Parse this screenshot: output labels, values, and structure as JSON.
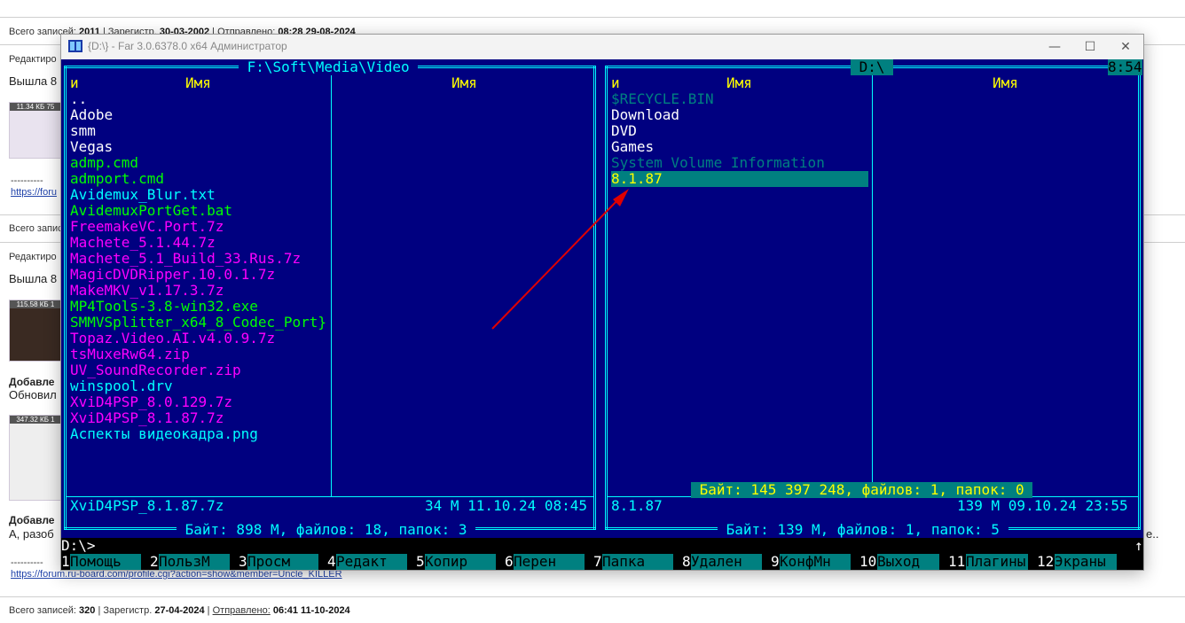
{
  "forum": {
    "top_line": {
      "records_label": "Всего записей:",
      "records": "2011",
      "reg_label": "Зарегистр.",
      "reg_date": "30-03-2002",
      "sent_label": "Отправлено:",
      "sent": "08:28 29-08-2024"
    },
    "edit1": "Редактиро",
    "out1": "Вышла 8",
    "thumb1": "11.34 КБ 75",
    "dashes1": "----------",
    "link1": "https://foru",
    "rec2": "Всего запис",
    "edit2": "Редактиро",
    "out2": "Вышла 8",
    "thumb2": "115.58 КБ 1",
    "added3": "Добавле",
    "upd3": "Обновил",
    "thumb3": "347.32 КБ 1",
    "added4": "Добавле",
    "text4": "А, разоб",
    "text4_tail": "е..",
    "dashes2": "----------",
    "link2": "https://forum.ru-board.com/profile.cgi?action=show&member=Uncle_KILLER",
    "bottom_line": {
      "records_label": "Всего записей:",
      "records": "320",
      "reg_label": "Зарегистр.",
      "reg_date": "27-04-2024",
      "sent_label": "Отправлено:",
      "sent": "06:41 11-10-2024"
    }
  },
  "window": {
    "title": "{D:\\} - Far 3.0.6378.0 x64 Администратор",
    "min_symbol": "—",
    "max_symbol": "☐",
    "close_symbol": "✕"
  },
  "left_panel": {
    "path": " F:\\Soft\\Media\\Video ",
    "col_n": "и",
    "col_name1": "Имя",
    "col_name2": "Имя",
    "files": [
      {
        "name": "..",
        "color": "#ffffff"
      },
      {
        "name": "Adobe",
        "color": "#ffffff"
      },
      {
        "name": "smm",
        "color": "#ffffff"
      },
      {
        "name": "Vegas",
        "color": "#ffffff"
      },
      {
        "name": "admp.cmd",
        "color": "#00ff00"
      },
      {
        "name": "admport.cmd",
        "color": "#00ff00"
      },
      {
        "name": "Avidemux_Blur.txt",
        "color": "#00ffff"
      },
      {
        "name": "AvidemuxPortGet.bat",
        "color": "#00ff00"
      },
      {
        "name": "FreemakeVC.Port.7z",
        "color": "#ff00ff"
      },
      {
        "name": "Machete_5.1.44.7z",
        "color": "#ff00ff"
      },
      {
        "name": "Machete_5.1_Build_33.Rus.7z",
        "color": "#ff00ff"
      },
      {
        "name": "MagicDVDRipper.10.0.1.7z",
        "color": "#ff00ff"
      },
      {
        "name": "MakeMKV_v1.17.3.7z",
        "color": "#ff00ff"
      },
      {
        "name": "MP4Tools-3.8-win32.exe",
        "color": "#00ff00"
      },
      {
        "name": "SMMVSplitter_x64_8_Codec_Port}",
        "color": "#00ff00"
      },
      {
        "name": "Topaz.Video.AI.v4.0.9.7z",
        "color": "#ff00ff"
      },
      {
        "name": "tsMuxeRw64.zip",
        "color": "#ff00ff"
      },
      {
        "name": "UV_SoundRecorder.zip",
        "color": "#ff00ff"
      },
      {
        "name": "winspool.drv",
        "color": "#00ffff"
      },
      {
        "name": "XviD4PSP_8.0.129.7z",
        "color": "#ff00ff"
      },
      {
        "name": "XviD4PSP_8.1.87.7z",
        "color": "#ff00ff"
      },
      {
        "name": "Аспекты видеокадра.png",
        "color": "#00ffff"
      }
    ],
    "status_name": "XviD4PSP_8.1.87.7z",
    "status_info": "34 M 11.10.24 08:45",
    "summary": " Байт: 898 M, файлов: 18, папок: 3 "
  },
  "right_panel": {
    "drive": " D:\\ ",
    "clock": "8:54",
    "col_n": "и",
    "col_name1": "Имя",
    "col_name2": "Имя",
    "files": [
      {
        "name": "$RECYCLE.BIN",
        "color": "#008080"
      },
      {
        "name": "Download",
        "color": "#ffffff"
      },
      {
        "name": "DVD",
        "color": "#ffffff"
      },
      {
        "name": "Games",
        "color": "#ffffff"
      },
      {
        "name": "System Volume Information",
        "color": "#008080"
      },
      {
        "name": "8.1.87",
        "color": "#ffff00",
        "selected": true
      }
    ],
    "selection_info": " Байт: 145 397 248, файлов: 1, папок: 0 ",
    "status_name": "8.1.87",
    "status_info": "139 M 09.10.24 23:55",
    "summary": " Байт: 139 M, файлов: 1, папок: 5 "
  },
  "command_line": {
    "prompt": "D:\\>",
    "scroll_arrow": "↑"
  },
  "keybar": [
    {
      "num": "1",
      "label": "Помощь"
    },
    {
      "num": "2",
      "label": "ПользМ"
    },
    {
      "num": "3",
      "label": "Просм"
    },
    {
      "num": "4",
      "label": "Редакт"
    },
    {
      "num": "5",
      "label": "Копир"
    },
    {
      "num": "6",
      "label": "Перен"
    },
    {
      "num": "7",
      "label": "Папка"
    },
    {
      "num": "8",
      "label": "Удален"
    },
    {
      "num": "9",
      "label": "КонфМн"
    },
    {
      "num": "10",
      "label": "Выход"
    },
    {
      "num": "11",
      "label": "Плагины"
    },
    {
      "num": "12",
      "label": "Экраны"
    }
  ],
  "colors": {
    "panel_bg": "#000080",
    "frame": "#00ffff",
    "header": "#ffff00",
    "selection_bg": "#008080",
    "keybar_bg": "#008080",
    "annotation_arrow": "#e00000"
  }
}
